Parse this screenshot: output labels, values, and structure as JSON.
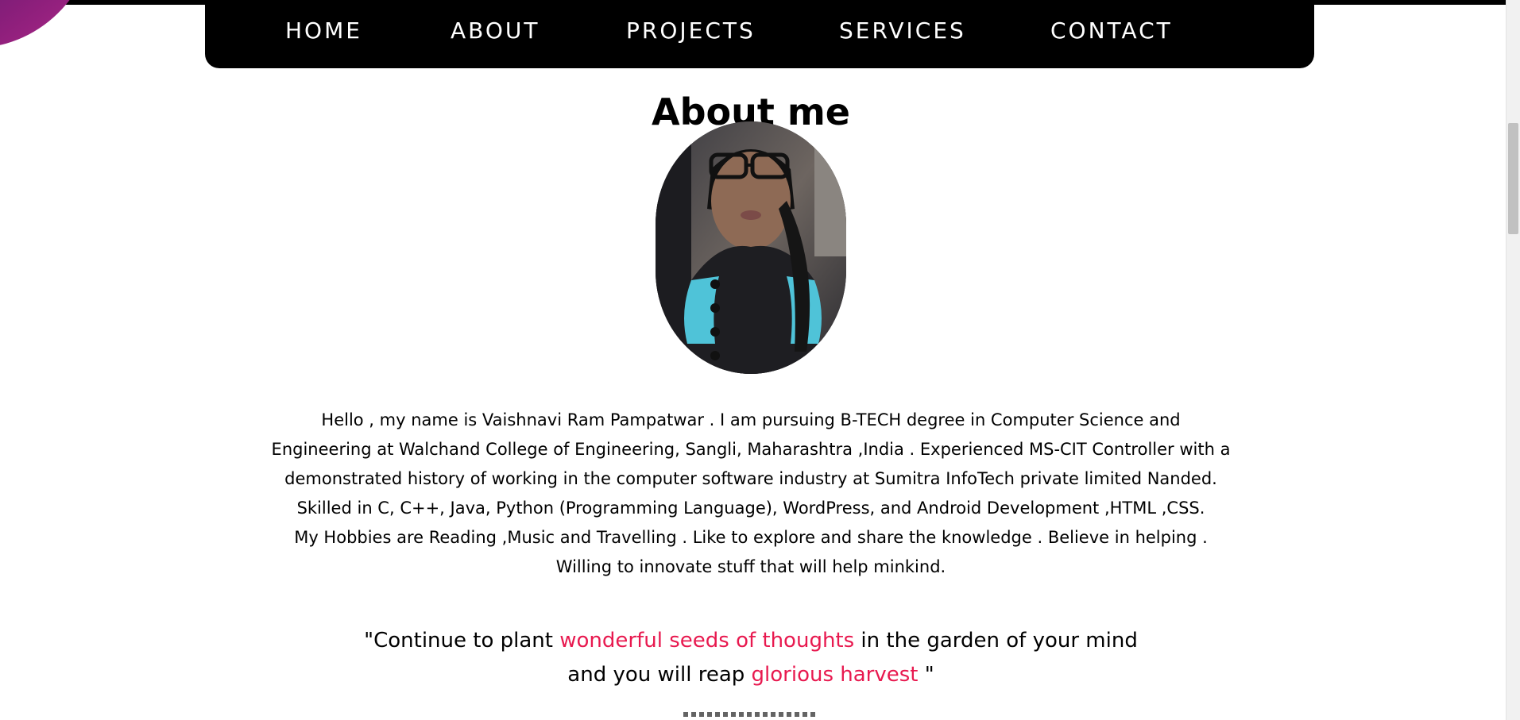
{
  "nav": {
    "items": [
      {
        "label": "HOME"
      },
      {
        "label": "ABOUT"
      },
      {
        "label": "PROJECTS"
      },
      {
        "label": "SERVICES"
      },
      {
        "label": "CONTACT"
      }
    ]
  },
  "about": {
    "title": "About me",
    "bio_paragraph_1": "Hello , my name is Vaishnavi Ram Pampatwar . I am pursuing B-TECH degree in Computer Science and Engineering at Walchand College of Engineering, Sangli, Maharashtra ,India . Experienced MS-CIT Controller with a demonstrated history of working in the computer software industry at Sumitra InfoTech private limited Nanded. Skilled in C, C++, Java, Python (Programming Language), WordPress, and Android Development ,HTML ,CSS.",
    "bio_paragraph_2": "My Hobbies are Reading ,Music and Travelling . Like to explore and share the knowledge . Believe in helping . Willing to innovate stuff that will help minkind."
  },
  "quote": {
    "part1": "\"Continue to plant ",
    "accent1": "wonderful seeds of thoughts",
    "part2": " in the garden of your mind",
    "part3": "and you will reap ",
    "accent2": "glorious harvest",
    "part4": " \""
  },
  "colors": {
    "accent": "#e8194f",
    "nav_background": "#000000",
    "nav_text": "#ffffff",
    "decoration": "#8f1f7c"
  }
}
